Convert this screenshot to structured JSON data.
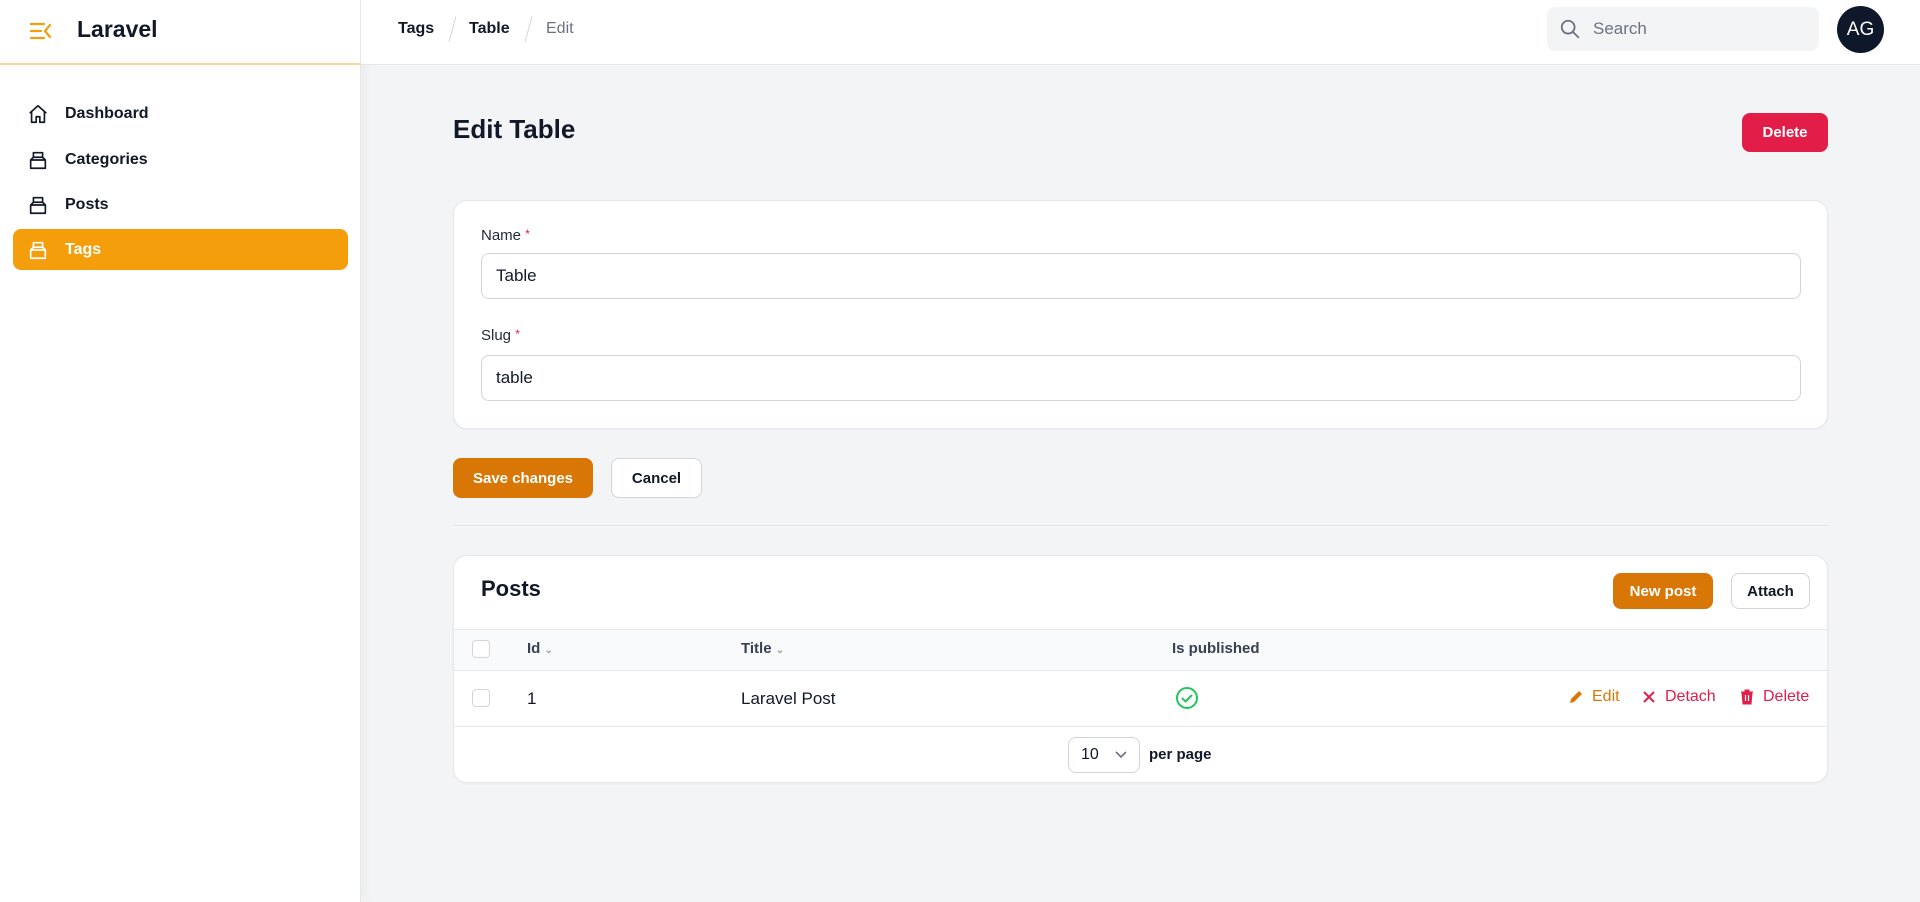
{
  "brand": {
    "name": "Laravel",
    "accent": "#f59e0b"
  },
  "sidebar": {
    "items": [
      {
        "label": "Dashboard",
        "icon": "home-icon",
        "active": false
      },
      {
        "label": "Categories",
        "icon": "inbox-stack-icon",
        "active": false
      },
      {
        "label": "Posts",
        "icon": "inbox-stack-icon",
        "active": false
      },
      {
        "label": "Tags",
        "icon": "inbox-stack-icon",
        "active": true
      }
    ]
  },
  "breadcrumbs": [
    "Tags",
    "Table",
    "Edit"
  ],
  "search": {
    "placeholder": "Search"
  },
  "user": {
    "initials": "AG"
  },
  "page": {
    "title": "Edit Table",
    "delete_label": "Delete"
  },
  "form": {
    "name": {
      "label": "Name",
      "required_mark": "*",
      "value": "Table"
    },
    "slug": {
      "label": "Slug",
      "required_mark": "*",
      "value": "table"
    },
    "save_label": "Save changes",
    "cancel_label": "Cancel"
  },
  "posts": {
    "title": "Posts",
    "new_label": "New post",
    "attach_label": "Attach",
    "columns": [
      "Id",
      "Title",
      "Is published"
    ],
    "rows": [
      {
        "id": "1",
        "title": "Laravel Post",
        "is_published": true,
        "actions": {
          "edit": "Edit",
          "detach": "Detach",
          "delete": "Delete"
        }
      }
    ],
    "per_page": {
      "value": "10",
      "label": "per page"
    }
  },
  "colors": {
    "primary": "#d97706",
    "danger": "#e11d48",
    "success": "#22c55e"
  }
}
